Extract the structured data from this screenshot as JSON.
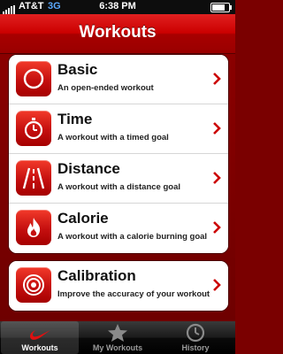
{
  "status_bar": {
    "carrier": "AT&T",
    "network": "3G",
    "time": "6:38 PM"
  },
  "nav": {
    "title": "Workouts"
  },
  "workouts": [
    {
      "title": "Basic",
      "subtitle": "An open-ended workout",
      "icon": "circle-icon"
    },
    {
      "title": "Time",
      "subtitle": "A workout with a timed goal",
      "icon": "stopwatch-icon"
    },
    {
      "title": "Distance",
      "subtitle": "A workout with a distance goal",
      "icon": "road-icon"
    },
    {
      "title": "Calorie",
      "subtitle": "A workout with a calorie burning goal",
      "icon": "flame-icon"
    }
  ],
  "calibration": {
    "title": "Calibration",
    "subtitle": "Improve the accuracy of your workout",
    "icon": "target-icon"
  },
  "tabs": [
    {
      "label": "Workouts",
      "icon": "swoosh-icon",
      "active": true
    },
    {
      "label": "My Workouts",
      "icon": "star-icon",
      "active": false
    },
    {
      "label": "History",
      "icon": "clock-icon",
      "active": false
    }
  ],
  "colors": {
    "accent": "#cc0000",
    "background": "#7a0000",
    "chevron": "#cc0000"
  }
}
